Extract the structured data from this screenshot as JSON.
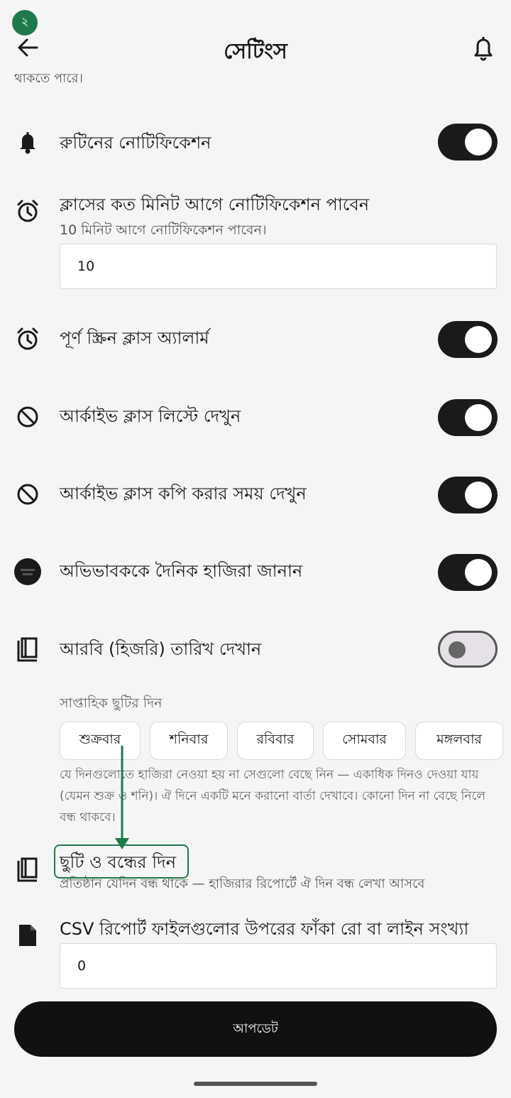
{
  "status": {
    "badge": "২"
  },
  "header": {
    "title": "সেটিংস"
  },
  "partial_text": "থাকতে পারে।",
  "settings": {
    "routine_notification": {
      "label": "রুটিনের নোটিফিকেশন",
      "enabled": true
    },
    "notify_minutes": {
      "label": "ক্লাসের কত মিনিট আগে নোটিফিকেশন পাবেন",
      "sub": "10 মিনিট আগে নোটিফিকেশন পাবেন।",
      "value": "10"
    },
    "fullscreen_alarm": {
      "label": "পূর্ণ স্ক্রিন ক্লাস অ্যালার্ম",
      "enabled": true
    },
    "archive_list": {
      "label": "আর্কাইভ ক্লাস লিস্টে দেখুন",
      "enabled": true
    },
    "archive_copy": {
      "label": "আর্কাইভ ক্লাস কপি করার সময় দেখুন",
      "enabled": true
    },
    "guardian_attendance": {
      "label": "অভিভাবককে দৈনিক হাজিরা জানান",
      "enabled": true
    },
    "hijri_date": {
      "label": "আরবি (হিজরি) তারিখ দেখান",
      "enabled": false
    }
  },
  "weekly_holiday": {
    "label": "সাপ্তাহিক ছুটির দিন",
    "days": [
      "শুক্রবার",
      "শনিবার",
      "রবিবার",
      "সোমবার",
      "মঙ্গলবার"
    ],
    "help": "যে দিনগুলোতে হাজিরা নেওয়া হয় না সেগুলো বেছে নিন — একাধিক দিনও দেওয়া যায় (যেমন শুক্র ও শনি)। ঐ দিনে একটি মনে করানো বার্তা দেখাবে। কোনো দিন না বেছে নিলে বন্ধ থাকবে।"
  },
  "holidays": {
    "label": "ছুটি ও বন্ধের দিন",
    "sub": "প্রতিষ্ঠান যেদিন বন্ধ থাকে — হাজিরার রিপোর্টে ঐ দিন বন্ধ লেখা আসবে"
  },
  "csv_rows": {
    "label": "CSV রিপোর্ট ফাইলগুলোর উপরের ফাঁকা রো বা লাইন সংখ্যা",
    "value": "0"
  },
  "update_button": "আপডেট",
  "colors": {
    "accent": "#1e7a4a",
    "toggle_on": "#1a1a1a",
    "background": "#f5f5f5"
  }
}
